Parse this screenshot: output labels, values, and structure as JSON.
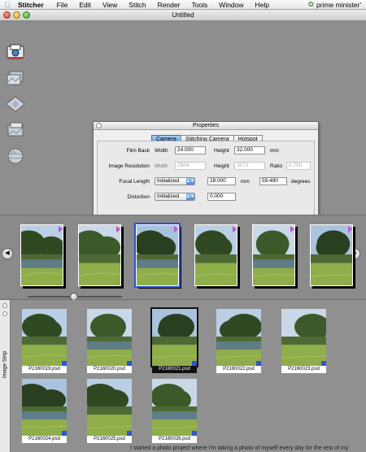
{
  "menubar": {
    "app": "Stitcher",
    "items": [
      "File",
      "Edit",
      "View",
      "Stitch",
      "Render",
      "Tools",
      "Window",
      "Help"
    ],
    "user": "prime minister'"
  },
  "window": {
    "title": "Untitled"
  },
  "properties": {
    "title": "Properties",
    "tabs": [
      {
        "label": "Camera",
        "active": true
      },
      {
        "label": "Stitching Camera",
        "active": false
      },
      {
        "label": "Hotspot",
        "active": false
      }
    ],
    "film_back": {
      "label": "Film Back",
      "width_label": "Width",
      "width": "24.000",
      "height_label": "Height",
      "height": "32.000",
      "unit": "mm"
    },
    "image_resolution": {
      "label": "Image Resolution",
      "width_label": "Width",
      "width": "2504",
      "height_label": "Height",
      "height": "3072",
      "ratio_label": "Ratio",
      "ratio": "0.750"
    },
    "focal_length": {
      "label": "Focal Length",
      "mode": "Initialized",
      "value": "28.000",
      "unit": "mm",
      "degrees_value": "59.490",
      "degrees_unit": "degrees"
    },
    "distortion": {
      "label": "Distortion",
      "mode": "Initialized",
      "value": "0.000"
    }
  },
  "image_strip": {
    "label": "Image Strip",
    "items": [
      {
        "name": "P2160019.psd"
      },
      {
        "name": "P2160020.psd"
      },
      {
        "name": "P2160021.psd"
      },
      {
        "name": "P2160022.psd"
      },
      {
        "name": "P2160023.psd"
      },
      {
        "name": "P2160024.psd"
      },
      {
        "name": "P2160025.psd"
      },
      {
        "name": "P2160026.psd"
      }
    ]
  },
  "footer_text": "I started a photo project where I'm taking a photo of myself every day for the rest of my"
}
